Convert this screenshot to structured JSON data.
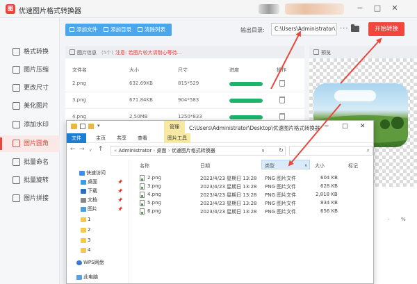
{
  "window": {
    "title": "优速图片格式转换器",
    "logo_glyph": "图"
  },
  "sidebar": {
    "items": [
      {
        "label": "格式转换",
        "active": false
      },
      {
        "label": "图片压缩",
        "active": false
      },
      {
        "label": "更改尺寸",
        "active": false
      },
      {
        "label": "美化图片",
        "active": false
      },
      {
        "label": "添加水印",
        "active": false
      },
      {
        "label": "图片圆角",
        "active": true
      },
      {
        "label": "批量命名",
        "active": false
      },
      {
        "label": "批量旋转",
        "active": false
      },
      {
        "label": "图片拼接",
        "active": false
      }
    ]
  },
  "toolbar": {
    "add_file": "添加文件",
    "add_dir": "添加目录",
    "clear_list": "清除列表",
    "output_label": "输出目录:",
    "output_path": "C:\\Users\\Administrator\\",
    "more": "···",
    "start": "开始转换"
  },
  "file_panel": {
    "title": "图片信息",
    "count": "(5个)",
    "note": "注意: 若图片较大请耐心等待...",
    "columns": {
      "name": "文件名",
      "size": "大小",
      "dims": "尺寸",
      "progress": "进度",
      "action": "操作"
    },
    "rows": [
      {
        "name": "2.png",
        "size": "632.69KB",
        "dims": "815*529",
        "progress": 1
      },
      {
        "name": "3.png",
        "size": "671.84KB",
        "dims": "904*583",
        "progress": 1
      },
      {
        "name": "4.png",
        "size": "2.50MB",
        "dims": "1250*833",
        "progress": 1
      }
    ]
  },
  "preview": {
    "title": "预览",
    "zoom_sep": "-",
    "zoom_unit": "%"
  },
  "explorer": {
    "manage_tab": "管理",
    "title_path": "C:\\Users\\Administrator\\Desktop\\优速图片格式转换器",
    "ribbon": [
      "文件",
      "主页",
      "共享",
      "查看",
      "图片工具"
    ],
    "address": [
      "Administrator",
      "桌面",
      "优速图片格式转换器"
    ],
    "columns": {
      "name": "名称",
      "date": "日期",
      "type": "类型",
      "size": "大小",
      "tags": "标记"
    },
    "tree": [
      {
        "label": "快速访问",
        "color": "#3d8ee8",
        "pin": false
      },
      {
        "label": "桌面",
        "color": "#3a9ee6",
        "pin": true
      },
      {
        "label": "下载",
        "color": "#2f6ebd",
        "pin": true
      },
      {
        "label": "文档",
        "color": "#888888",
        "pin": true
      },
      {
        "label": "图片",
        "color": "#4aa0d9",
        "pin": true
      },
      {
        "label": "1",
        "color": "#f2c94c",
        "pin": false
      },
      {
        "label": "2",
        "color": "#f2c94c",
        "pin": false
      },
      {
        "label": "3",
        "color": "#f2c94c",
        "pin": false
      },
      {
        "label": "4",
        "color": "#f2c94c",
        "pin": false
      },
      {
        "label": "WPS网盘",
        "color": "#3a7bd5",
        "pin": false
      },
      {
        "label": "此电脑",
        "color": "#5aa0e0",
        "pin": false
      }
    ],
    "files": [
      {
        "name": "2.png",
        "date": "2023/4/23 星期日 13:28",
        "type": "PNG 图片文件",
        "size": "604 KB"
      },
      {
        "name": "3.png",
        "date": "2023/4/23 星期日 13:28",
        "type": "PNG 图片文件",
        "size": "628 KB"
      },
      {
        "name": "4.png",
        "date": "2023/4/23 星期日 13:28",
        "type": "PNG 图片文件",
        "size": "2,818 KB"
      },
      {
        "name": "5.png",
        "date": "2023/4/23 星期日 13:28",
        "type": "PNG 图片文件",
        "size": "834 KB"
      },
      {
        "name": "6.png",
        "date": "2023/4/23 星期日 13:28",
        "type": "PNG 图片文件",
        "size": "656 KB"
      }
    ]
  },
  "colors": {
    "accent": "#f0463c",
    "toolbar": "#4ba7ea",
    "progress": "#1cb36b",
    "annotation": "#e8473d"
  }
}
